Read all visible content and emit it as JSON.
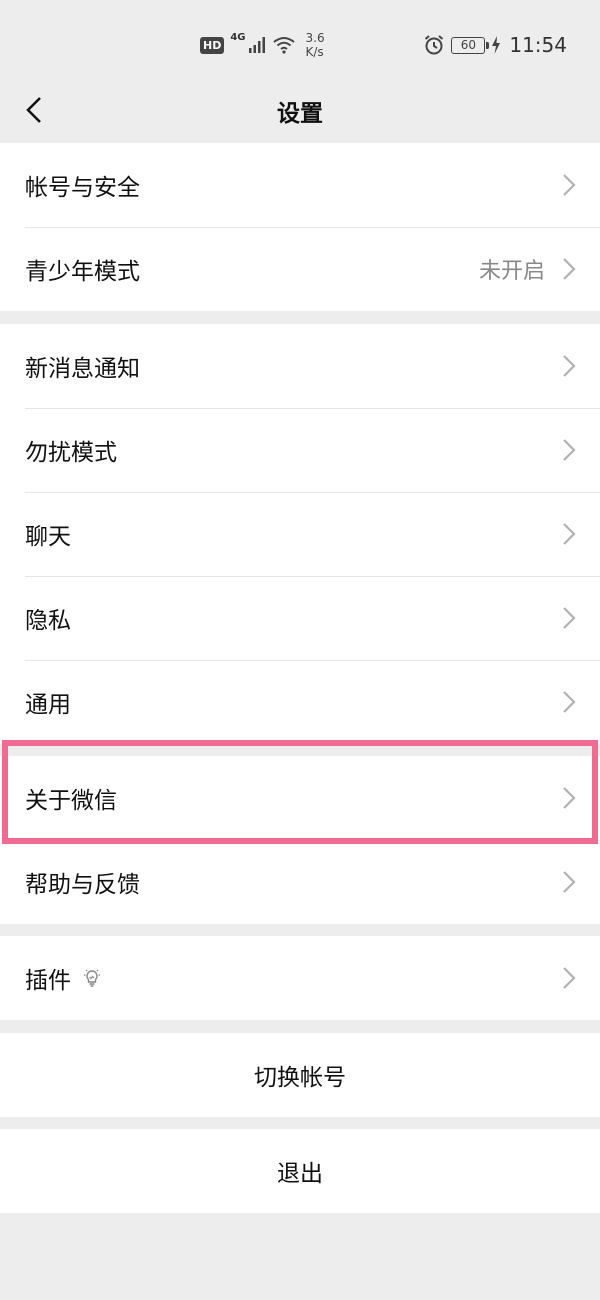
{
  "status_bar": {
    "hd": "HD",
    "network": "4G",
    "speed_value": "3.6",
    "speed_unit": "K/s",
    "battery": "60",
    "time": "11:54"
  },
  "header": {
    "title": "设置"
  },
  "groups": [
    {
      "items": [
        {
          "label": "帐号与安全",
          "value": ""
        },
        {
          "label": "青少年模式",
          "value": "未开启"
        }
      ]
    },
    {
      "items": [
        {
          "label": "新消息通知",
          "value": ""
        },
        {
          "label": "勿扰模式",
          "value": ""
        },
        {
          "label": "聊天",
          "value": ""
        },
        {
          "label": "隐私",
          "value": ""
        },
        {
          "label": "通用",
          "value": ""
        }
      ]
    },
    {
      "items": [
        {
          "label": "关于微信",
          "value": ""
        },
        {
          "label": "帮助与反馈",
          "value": ""
        }
      ]
    },
    {
      "items": [
        {
          "label": "插件",
          "value": ""
        }
      ]
    }
  ],
  "actions": {
    "switch_account": "切换帐号",
    "logout": "退出"
  },
  "colors": {
    "background": "#ededed",
    "highlight": "#f06b92",
    "chevron": "#b2b2b2",
    "secondary_text": "#888888"
  },
  "icons": {
    "back": "chevron-left-icon",
    "row_arrow": "chevron-right-icon",
    "plugin": "lightbulb-icon",
    "alarm": "alarm-clock-icon",
    "wifi": "wifi-icon",
    "signal": "signal-bars-icon",
    "charging": "lightning-icon"
  }
}
